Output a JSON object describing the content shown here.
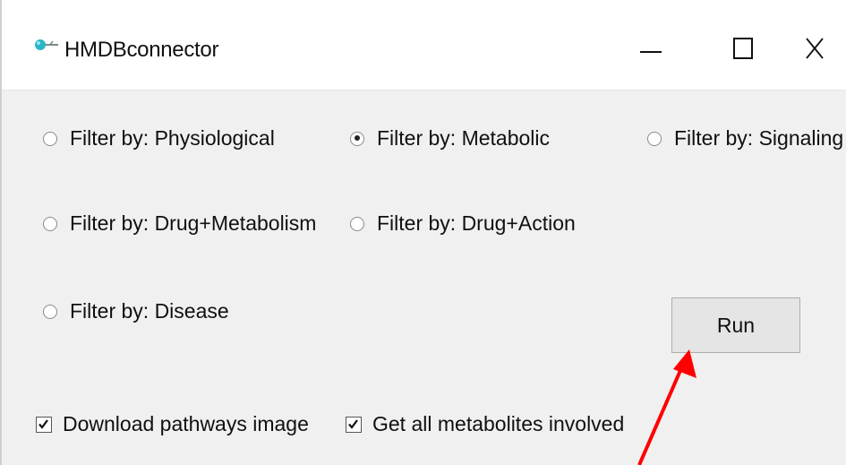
{
  "window": {
    "title": "HMDBconnector",
    "controls": {
      "minimize": "–",
      "maximize": "☐",
      "close": "X"
    }
  },
  "filters": [
    {
      "label": "Filter by: Physiological",
      "selected": false
    },
    {
      "label": "Filter by: Metabolic",
      "selected": true
    },
    {
      "label": "Filter by: Signaling",
      "selected": false
    },
    {
      "label": "Filter by: Drug+Metabolism",
      "selected": false
    },
    {
      "label": "Filter by: Drug+Action",
      "selected": false
    },
    {
      "label": "Filter by: Disease",
      "selected": false
    }
  ],
  "run_button": {
    "label": "Run"
  },
  "options": [
    {
      "label": "Download pathways image",
      "checked": true
    },
    {
      "label": "Get all metabolites involved",
      "checked": true
    }
  ],
  "annotation": {
    "arrow_color": "#ff0000"
  },
  "icons": {
    "app": "app-icon",
    "minimize": "minimize-icon",
    "maximize": "maximize-icon",
    "close": "close-icon"
  }
}
